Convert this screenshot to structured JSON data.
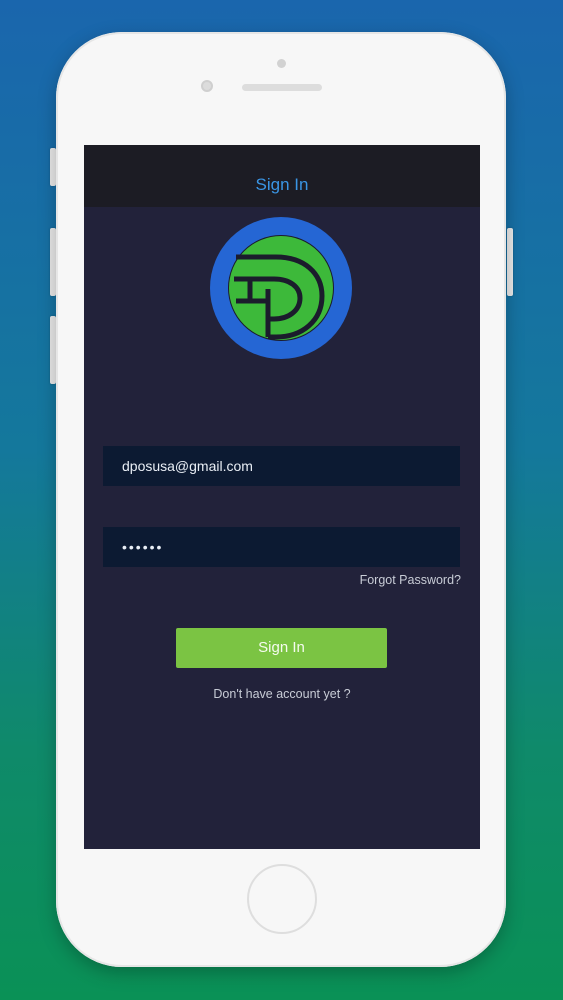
{
  "header": {
    "title": "Sign In"
  },
  "logo": {
    "icon": "dpos-logo",
    "ring_color": "#2566d4",
    "mark_color": "#3db93a"
  },
  "login_form": {
    "email_value": "dposusa@gmail.com",
    "password_value": "••••••",
    "forgot_password_label": "Forgot Password?",
    "sign_in_label": "Sign In",
    "no_account_label": "Don't have account yet ?"
  },
  "colors": {
    "accent_blue": "#3a95e4",
    "button_green": "#7bc443",
    "screen_background": "#22223a",
    "input_background": "#0c1a32"
  }
}
